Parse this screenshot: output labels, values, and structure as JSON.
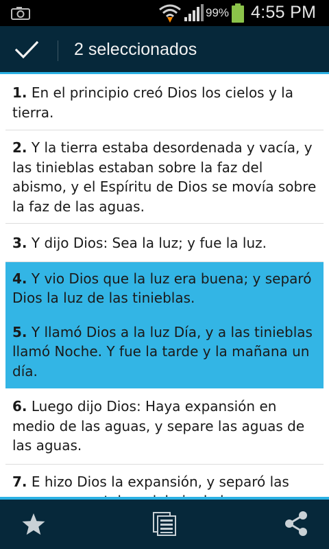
{
  "status_bar": {
    "battery_percent": "99%",
    "time": "4:55 PM",
    "icons": [
      "camera-icon",
      "wifi-icon",
      "signal-icon",
      "battery-icon"
    ]
  },
  "action_bar": {
    "title": "2 seleccionados",
    "done_icon": "check-icon"
  },
  "verses": [
    {
      "num": "1.",
      "text": " En el principio creó Dios los cielos y la tierra.",
      "selected": false
    },
    {
      "num": "2.",
      "text": " Y la tierra estaba desordenada y vacía, y las tinieblas estaban sobre la faz del abismo, y el Espíritu de Dios se movía sobre la faz de las aguas.",
      "selected": false
    },
    {
      "num": "3.",
      "text": " Y dijo Dios: Sea la luz; y fue la luz.",
      "selected": false
    },
    {
      "num": "4.",
      "text": " Y vio Dios que la luz era buena; y separó Dios la luz de las tinieblas.",
      "selected": true
    },
    {
      "num": "5.",
      "text": " Y llamó Dios a la luz Día, y a las tinieblas llamó Noche. Y fue la tarde y la mañana un día.",
      "selected": true
    },
    {
      "num": "6.",
      "text": " Luego dijo Dios: Haya expansión en medio de las aguas, y separe las aguas de las aguas.",
      "selected": false
    },
    {
      "num": "7.",
      "text": " E hizo Dios la expansión, y separó las aguas que estaban debajo de la",
      "selected": false
    }
  ],
  "bottom_bar": {
    "buttons": [
      "star-icon",
      "copy-icon",
      "share-icon"
    ]
  },
  "colors": {
    "action_bar_bg": "#06283a",
    "accent": "#33b5e5",
    "selected_bg": "#33b5e5"
  }
}
